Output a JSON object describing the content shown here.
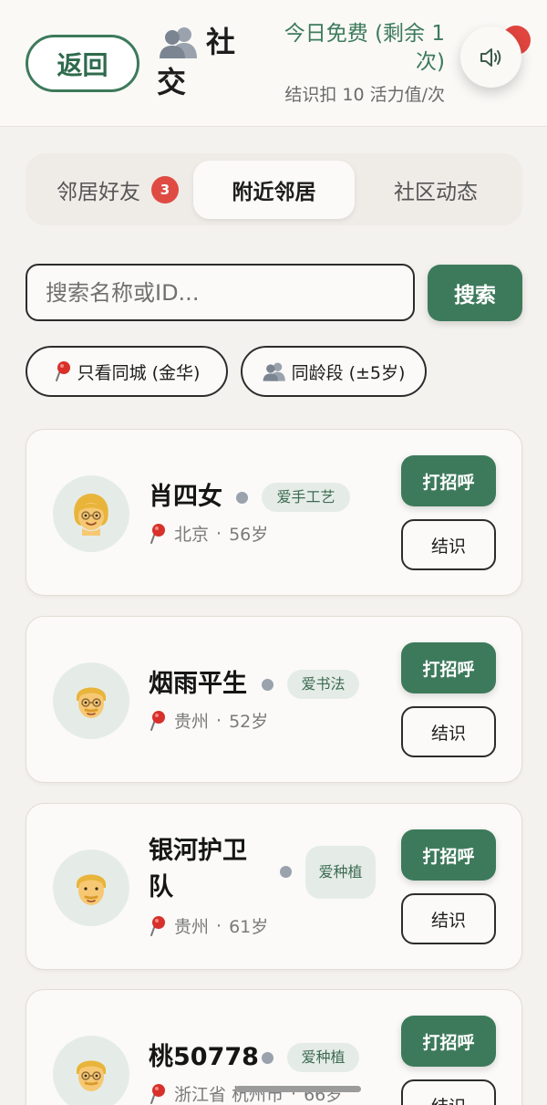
{
  "header": {
    "back_label": "返回",
    "title": "社交",
    "free_status": "今日免费 (剩余 1 次)",
    "cost_info": "结识扣 10 活力值/次",
    "sound_icon": "speaker-icon"
  },
  "tabs": [
    {
      "label": "邻居好友",
      "badge": "3"
    },
    {
      "label": "附近邻居"
    },
    {
      "label": "社区动态"
    }
  ],
  "search": {
    "placeholder": "搜索名称或ID...",
    "value": "",
    "button_label": "搜索"
  },
  "filters": [
    {
      "label": "只看同城 (金华)",
      "icon": "pin-icon"
    },
    {
      "label": "同龄段 (±5岁)",
      "icon": "people-icon"
    }
  ],
  "neighbors": [
    {
      "name": "肖四女",
      "tag": "爱手工艺",
      "city": "北京",
      "age": "56岁",
      "avatar": "woman-avatar"
    },
    {
      "name": "烟雨平生",
      "tag": "爱书法",
      "city": "贵州",
      "age": "52岁",
      "avatar": "man-avatar"
    },
    {
      "name": "银河护卫队",
      "tag": "爱种植",
      "city": "贵州",
      "age": "61岁",
      "avatar": "man-avatar"
    },
    {
      "name": "桃50778",
      "tag": "爱种植",
      "city": "浙江省 杭州市",
      "age": "66岁",
      "avatar": "man-avatar"
    }
  ],
  "actions": {
    "greet_label": "打招呼",
    "meet_label": "结识"
  },
  "colors": {
    "brand_green": "#3d7a5b",
    "badge_red": "#df4b43",
    "background": "#f4f2ee"
  }
}
